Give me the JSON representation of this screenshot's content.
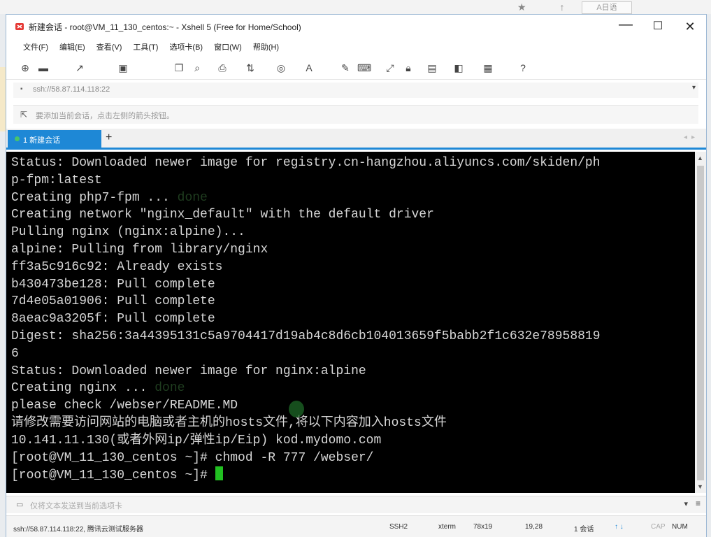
{
  "window": {
    "title": "新建会话 - root@VM_11_130_centos:~ - Xshell 5 (Free for Home/School)",
    "controls": {
      "minimize": "—",
      "maximize": "☐",
      "close": "✕"
    }
  },
  "background": {
    "icons": "★ ↑",
    "tab_label": "A日语"
  },
  "menu": [
    "文件(F)",
    "编辑(E)",
    "查看(V)",
    "工具(T)",
    "选项卡(B)",
    "窗口(W)",
    "帮助(H)"
  ],
  "address_bar": {
    "icon": "lock-icon",
    "text": "ssh://58.87.114.118:22"
  },
  "tip_bar": {
    "text": "要添加当前会话，点击左侧的箭头按钮。"
  },
  "tabs": [
    {
      "label": "1 新建会话",
      "active": true
    }
  ],
  "tab_add": "+",
  "terminal": {
    "lines": [
      "Status: Downloaded newer image for registry.cn-hangzhou.aliyuncs.com/skiden/ph",
      "p-fpm:latest",
      "Creating php7-fpm ... ",
      "Creating network \"nginx_default\" with the default driver",
      "Pulling nginx (nginx:alpine)...",
      "alpine: Pulling from library/nginx",
      "ff3a5c916c92: Already exists",
      "b430473be128: Pull complete",
      "7d4e05a01906: Pull complete",
      "8aeac9a3205f: Pull complete",
      "Digest: sha256:3a44395131c5a9704417d19ab4c8d6cb104013659f5babb2f1c632e78958819",
      "6",
      "Status: Downloaded newer image for nginx:alpine",
      "Creating nginx ... ",
      "please check /webser/README.MD",
      "请修改需要访问网站的电脑或者主机的hosts文件,将以下内容加入hosts文件",
      "10.141.11.130(或者外网ip/弹性ip/Eip) kod.mydomo.com",
      "[root@VM_11_130_centos ~]# chmod -R 777 /webser/"
    ],
    "done_word": "done",
    "prompt": "[root@VM_11_130_centos ~]# "
  },
  "input_bar": {
    "placeholder": "仅将文本发送到当前选项卡"
  },
  "status_bar": {
    "connection": "ssh://58.87.114.118:22, 腾讯云测试服务器",
    "protocol": "SSH2",
    "term": "xterm",
    "size": "78x19",
    "cursor_pos": "19,28",
    "sessions": "1 会话",
    "caps": "CAP",
    "num": "NUM"
  },
  "colors": {
    "accent": "#1e88d6",
    "terminal_bg": "#000000",
    "terminal_fg": "#d7d7d7",
    "cursor": "#21c021"
  }
}
